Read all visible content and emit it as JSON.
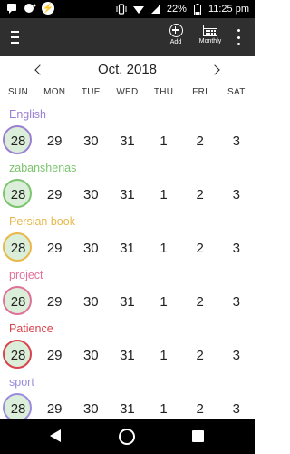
{
  "status_bar": {
    "battery": "22%",
    "time": "11:25 pm",
    "icons": [
      "notification-icon",
      "record-icon",
      "lightning-icon",
      "vibrate-icon",
      "wifi-icon",
      "signal-icon",
      "battery-icon"
    ]
  },
  "toolbar": {
    "add_label": "Add",
    "monthly_label": "Monthly"
  },
  "calendar": {
    "month_title": "Oct. 2018",
    "weekdays": [
      "SUN",
      "MON",
      "TUE",
      "WED",
      "THU",
      "FRI",
      "SAT"
    ],
    "days": [
      "28",
      "29",
      "30",
      "31",
      "1",
      "2",
      "3"
    ]
  },
  "habits": [
    {
      "name": "English",
      "color": "#9b7fd4"
    },
    {
      "name": "zabanshenas",
      "color": "#7cc46e"
    },
    {
      "name": "Persian book",
      "color": "#e8b84a"
    },
    {
      "name": "project",
      "color": "#e07098"
    },
    {
      "name": "Patience",
      "color": "#d8434d"
    },
    {
      "name": "sport",
      "color": "#9b8ce0"
    }
  ]
}
